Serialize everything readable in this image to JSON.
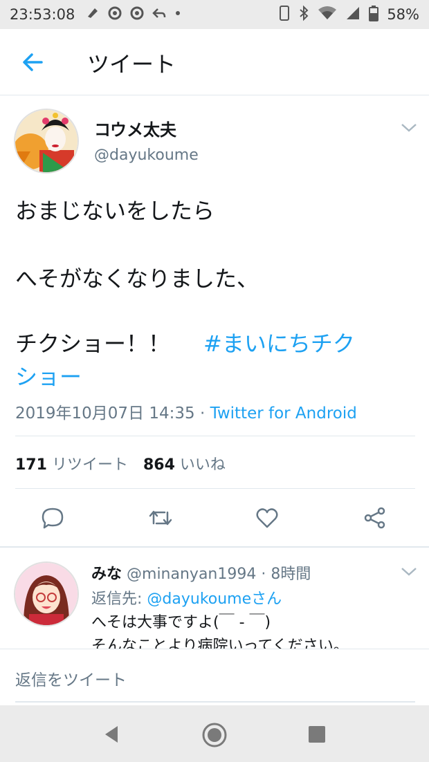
{
  "status_bar": {
    "time": "23:53:08",
    "battery": "58%",
    "icons": [
      "notification-icon",
      "at-icon",
      "at-icon",
      "reply-icon",
      "dot-icon",
      "phone-icon",
      "bluetooth-icon",
      "wifi-icon",
      "signal-icon",
      "battery-icon"
    ]
  },
  "header": {
    "title": "ツイート"
  },
  "tweet": {
    "author_name": "コウメ太夫",
    "author_handle": "@dayukoume",
    "lines": [
      "おまじないをしたら",
      "へそがなくなりました、",
      "チクショー！！"
    ],
    "hashtag_part1": "#まいにちチク",
    "hashtag_part2": "ショー",
    "timestamp": "2019年10月07日 14:35 · ",
    "source": "Twitter for Android",
    "retweet_count": "171",
    "retweet_label": "リツイート",
    "like_count": "864",
    "like_label": "いいね"
  },
  "reply": {
    "name": "みな",
    "handle": "@minanyan1994 · 8時間",
    "reply_to_label": "返信先: ",
    "reply_to_handle": "@dayukoumeさん",
    "line1": "へそは大事ですよ(￣ - ￣)",
    "line2": "そんなことより病院いってください。"
  },
  "composer": {
    "placeholder": "返信をツイート"
  },
  "colors": {
    "accent": "#1da1f2",
    "secondary_text": "#657786",
    "divider": "#e1e8ed",
    "text": "#14171a"
  }
}
